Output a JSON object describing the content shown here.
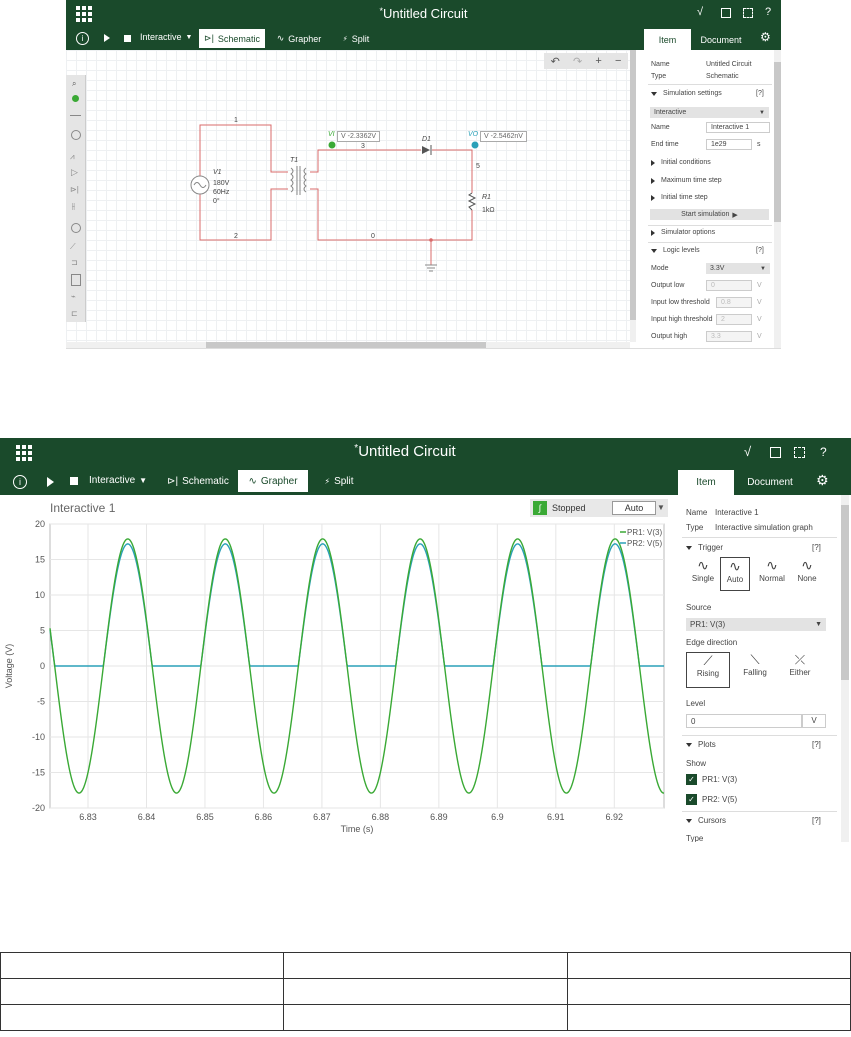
{
  "app": {
    "title": "Untitled Circuit",
    "title_marker": "*",
    "mode_label": "Interactive",
    "views": [
      "Schematic",
      "Grapher",
      "Split"
    ],
    "help_label": "?",
    "panel_tabs": [
      "Item",
      "Document"
    ]
  },
  "schematic_panel": {
    "name_label": "Name",
    "name_value": "Untitled Circuit",
    "type_label": "Type",
    "type_value": "Schematic",
    "sim_settings": "Simulation settings",
    "help": "[?]",
    "sim_mode": "Interactive",
    "sim_name_label": "Name",
    "sim_name_value": "Interactive 1",
    "end_time_label": "End time",
    "end_time_value": "1e29",
    "end_time_unit": "s",
    "initial_conditions": "Initial conditions",
    "max_time_step": "Maximum time step",
    "initial_time_step": "Initial time step",
    "start_button": "Start simulation",
    "simulator_options": "Simulator options",
    "logic_levels": "Logic levels",
    "logic_mode_label": "Mode",
    "logic_mode_value": "3.3V",
    "output_low_label": "Output low",
    "output_low_value": "0",
    "output_low_unit": "V",
    "in_low_label": "Input low threshold",
    "in_low_value": "0.8",
    "in_low_unit": "V",
    "in_high_label": "Input high threshold",
    "in_high_value": "2",
    "in_high_unit": "V",
    "output_high_label": "Output high",
    "output_high_value": "3.3",
    "output_high_unit": "V"
  },
  "circuit": {
    "source_name": "V1",
    "source_v": "180V",
    "source_f": "60Hz",
    "source_phase": "0°",
    "transformer": "T1",
    "diode": "D1",
    "resistor": "R1",
    "resistor_value": "1kΩ",
    "probe_vi_name": "VI",
    "probe_vi_value": "V -2.3362V",
    "probe_vo_name": "VO",
    "probe_vo_value": "V -2.5462nV",
    "net_1": "1",
    "net_2": "2",
    "net_0": "0",
    "net_3": "3",
    "net_5": "5"
  },
  "grapher": {
    "graph_title": "Interactive 1",
    "status": "Stopped",
    "trigger_select": "Auto"
  },
  "grapher_panel": {
    "name_label": "Name",
    "name_value": "Interactive 1",
    "type_label": "Type",
    "type_value": "Interactive simulation graph",
    "trigger": "Trigger",
    "help": "[?]",
    "trigger_modes": [
      "Single",
      "Auto",
      "Normal",
      "None"
    ],
    "source_label": "Source",
    "source_value": "PR1: V(3)",
    "edge_label": "Edge direction",
    "edges": [
      "Rising",
      "Falling",
      "Either"
    ],
    "level_label": "Level",
    "level_value": "0",
    "level_unit": "V",
    "plots": "Plots",
    "show_label": "Show",
    "plot_items": [
      "PR1: V(3)",
      "PR2: V(5)"
    ],
    "cursors": "Cursors",
    "cursor_type": "Type"
  },
  "chart_data": {
    "type": "line",
    "title": "",
    "xlabel": "Time (s)",
    "ylabel": "Voltage (V)",
    "xlim": [
      6.8235,
      6.9285
    ],
    "ylim": [
      -20,
      20
    ],
    "x_ticks": [
      6.83,
      6.84,
      6.85,
      6.86,
      6.87,
      6.88,
      6.89,
      6.9,
      6.91,
      6.92
    ],
    "x_tick_labels": [
      "6.83",
      "6.84",
      "6.85",
      "6.86",
      "6.87",
      "6.88",
      "6.89",
      "6.9",
      "6.91",
      "6.92"
    ],
    "y_ticks": [
      -20,
      -15,
      -10,
      -5,
      0,
      5,
      10,
      15,
      20
    ],
    "grid": true,
    "legend_position": "top-right",
    "series": [
      {
        "name": "PR1: V(3)",
        "color": "#3aa935",
        "kind": "sine",
        "amplitude": 17.9,
        "frequency_hz": 60,
        "peak_time": 6.8368
      },
      {
        "name": "PR2: V(5)",
        "color": "#2aa0b8",
        "kind": "half_wave_rectified",
        "amplitude": 17.2,
        "frequency_hz": 60,
        "peak_time": 6.8368
      }
    ]
  },
  "colors": {
    "chrome": "#1a4a2b",
    "wire": "#d96b6b",
    "trace_v3": "#3aa935",
    "trace_v5": "#2aa0b8"
  },
  "icons": [
    "app-grid-icon",
    "info-icon",
    "play-icon",
    "stop-icon",
    "diode-view-icon",
    "wave-view-icon",
    "split-view-icon",
    "sqrt-tools-icon",
    "export-icon",
    "fullscreen-icon",
    "gear-icon",
    "undo-icon",
    "redo-icon",
    "zoom-in-icon",
    "zoom-out-icon"
  ],
  "table": {
    "rows": [
      [
        "",
        "",
        ""
      ],
      [
        "",
        "",
        ""
      ],
      [
        "",
        "",
        ""
      ]
    ]
  }
}
